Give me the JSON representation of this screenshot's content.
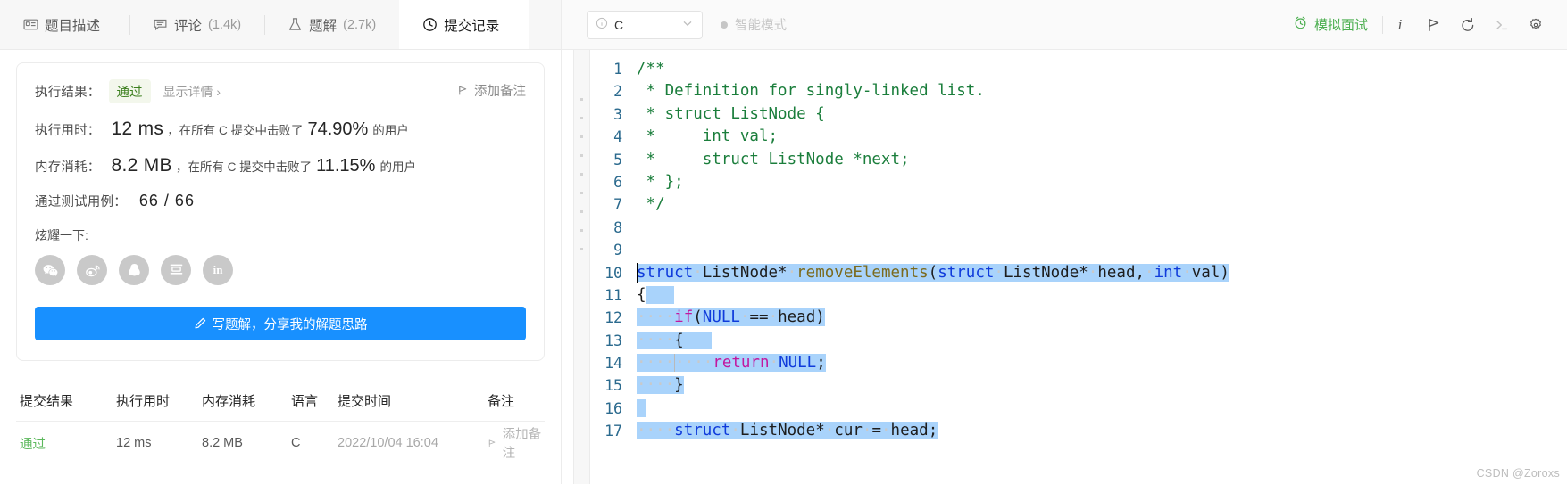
{
  "left_panel": {
    "tabs": [
      {
        "id": "description",
        "icon": "article-icon",
        "label": "题目描述",
        "count": "",
        "active": false
      },
      {
        "id": "comments",
        "icon": "comment-icon",
        "label": "评论",
        "count": "(1.4k)",
        "active": false
      },
      {
        "id": "solutions",
        "icon": "flask-icon",
        "label": "题解",
        "count": "(2.7k)",
        "active": false
      },
      {
        "id": "submissions",
        "icon": "clock-icon",
        "label": "提交记录",
        "count": "",
        "active": true
      }
    ],
    "result": {
      "result_label": "执行结果：",
      "status_badge": "通过",
      "detail_link": "显示详情 ›",
      "add_note": "添加备注",
      "runtime_label": "执行用时：",
      "runtime_value": "12 ms",
      "runtime_mid": "，在所有 C 提交中击败了",
      "runtime_percent": "74.90%",
      "runtime_suffix": "的用户",
      "memory_label": "内存消耗：",
      "memory_value": "8.2 MB",
      "memory_mid": "，在所有 C 提交中击败了",
      "memory_percent": "11.15%",
      "memory_suffix": "的用户",
      "testcases_label": "通过测试用例：",
      "testcases_value": "66 / 66",
      "share_label": "炫耀一下:",
      "share_icons": [
        "wechat-icon",
        "weibo-icon",
        "qq-icon",
        "douban-icon",
        "linkedin-icon"
      ],
      "write_solution_button": "写题解，分享我的解题思路"
    },
    "submissions_table": {
      "headers": [
        "提交结果",
        "执行用时",
        "内存消耗",
        "语言",
        "提交时间",
        "备注"
      ],
      "rows": [
        {
          "status": "通过",
          "runtime": "12 ms",
          "memory": "8.2 MB",
          "language": "C",
          "time": "2022/10/04 16:04",
          "note": "添加备注"
        }
      ]
    }
  },
  "editor": {
    "toolbar": {
      "language_selected": "C",
      "language_info_icon": "info-circle-icon",
      "language_caret_icon": "chevron-down-icon",
      "smart_mode_label": "智能模式",
      "smart_mode_dot": "status-dot",
      "mock_interview_label": "模拟面试",
      "mock_interview_icon": "alarm-clock-icon",
      "icons": [
        {
          "name": "info-italic-icon",
          "glyph": "i",
          "dim": false
        },
        {
          "name": "run-flag-icon",
          "glyph": "flag",
          "dim": false
        },
        {
          "name": "reset-undo-icon",
          "glyph": "undo",
          "dim": false
        },
        {
          "name": "console-terminal-icon",
          "glyph": "terminal",
          "dim": true
        },
        {
          "name": "settings-gear-icon",
          "glyph": "gear",
          "dim": false
        }
      ]
    },
    "accent_colors": {
      "primary_blue": "#1890ff",
      "pass_green": "#5cb85c",
      "selection_blue": "#a9d3fb",
      "comment_green": "#1b7e3c",
      "keyword_blue": "#0f3bdb",
      "control_magenta": "#c2189f",
      "function_olive": "#7b6a1e",
      "line_number": "#2b6a8e"
    },
    "code_lines": [
      {
        "n": "1",
        "text": "/**"
      },
      {
        "n": "2",
        "text": " * Definition for singly-linked list."
      },
      {
        "n": "3",
        "text": " * struct ListNode {"
      },
      {
        "n": "4",
        "text": " *     int val;"
      },
      {
        "n": "5",
        "text": " *     struct ListNode *next;"
      },
      {
        "n": "6",
        "text": " * };"
      },
      {
        "n": "7",
        "text": " */"
      },
      {
        "n": "8",
        "text": ""
      },
      {
        "n": "9",
        "text": ""
      },
      {
        "n": "10",
        "text": "struct ListNode* removeElements(struct ListNode* head, int val)"
      },
      {
        "n": "11",
        "text": "{"
      },
      {
        "n": "12",
        "text": "    if(NULL == head)"
      },
      {
        "n": "13",
        "text": "    {"
      },
      {
        "n": "14",
        "text": "        return NULL;"
      },
      {
        "n": "15",
        "text": "    }"
      },
      {
        "n": "16",
        "text": ""
      },
      {
        "n": "17",
        "text": "    struct ListNode* cur = head;"
      }
    ]
  },
  "watermark": "CSDN @Zoroxs"
}
